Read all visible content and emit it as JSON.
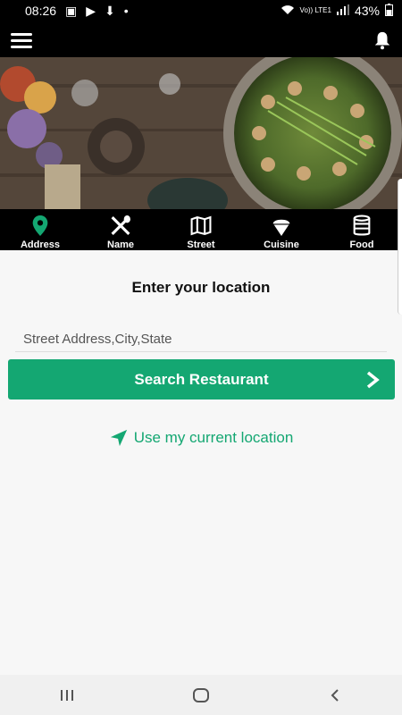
{
  "status_bar": {
    "time": "08:26",
    "network": "Vo)) LTE1",
    "battery": "43%"
  },
  "tabs": [
    {
      "label": "Address",
      "icon": "map-pin-icon"
    },
    {
      "label": "Name",
      "icon": "fork-spoon-icon"
    },
    {
      "label": "Street",
      "icon": "map-icon"
    },
    {
      "label": "Cuisine",
      "icon": "ice-cream-icon"
    },
    {
      "label": "Food",
      "icon": "can-icon"
    }
  ],
  "main": {
    "title": "Enter your location",
    "address_placeholder": "Street Address,City,State",
    "address_value": "",
    "search_button": "Search Restaurant",
    "current_location": "Use my current location"
  },
  "colors": {
    "accent": "#14a772",
    "bar_bg": "#000000",
    "page_bg": "#f7f7f7"
  }
}
